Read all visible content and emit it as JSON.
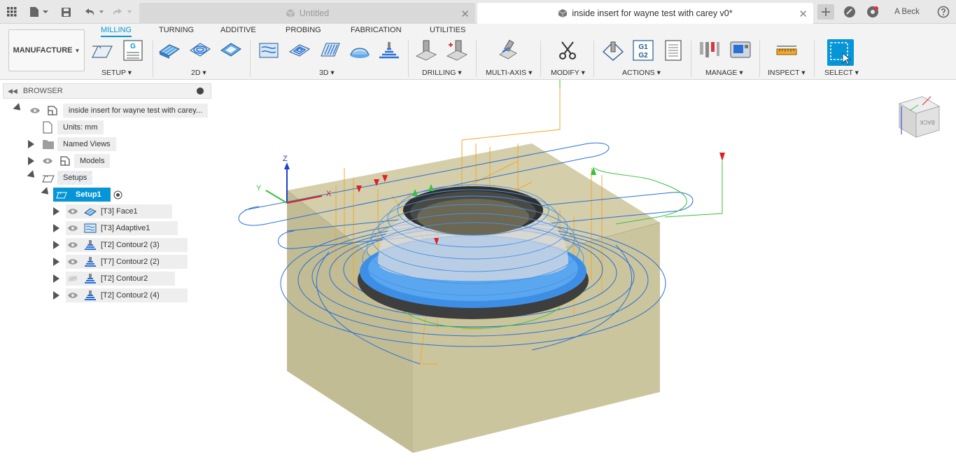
{
  "titlebar": {
    "tabs": [
      {
        "title": "Untitled",
        "active": false
      },
      {
        "title": "inside insert for wayne test with carey v0*",
        "active": true
      }
    ],
    "user": "A Beck"
  },
  "ribbon": {
    "workspace": "MANUFACTURE",
    "tabs": [
      "MILLING",
      "TURNING",
      "ADDITIVE",
      "PROBING",
      "FABRICATION",
      "UTILITIES"
    ],
    "active_tab": "MILLING",
    "groups": [
      "SETUP",
      "2D",
      "3D",
      "DRILLING",
      "MULTI-AXIS",
      "MODIFY",
      "ACTIONS",
      "MANAGE",
      "INSPECT",
      "SELECT"
    ],
    "g1g2_text": [
      "G1",
      "G2"
    ],
    "g_text": "G"
  },
  "browser": {
    "title": "BROWSER",
    "root": "inside insert for wayne test with carey...",
    "units": "Units: mm",
    "named_views": "Named Views",
    "models": "Models",
    "setups": "Setups",
    "setup1": "Setup1",
    "operations": [
      "[T3] Face1",
      "[T3] Adaptive1",
      "[T2] Contour2 (3)",
      "[T7] Contour2 (2)",
      "[T2] Contour2",
      "[T2] Contour2 (4)"
    ]
  },
  "viewport": {
    "axis_labels": {
      "z": "Z",
      "y": "Y",
      "x": "X"
    },
    "viewcube_face": "BACK",
    "colors": {
      "accent": "#0696d7",
      "stock": "#c8c39a",
      "toolpath_blue": "#2a6fd6",
      "toolpath_orange": "#f0a830",
      "toolpath_green": "#36c23c",
      "marker_red": "#e02020"
    }
  }
}
